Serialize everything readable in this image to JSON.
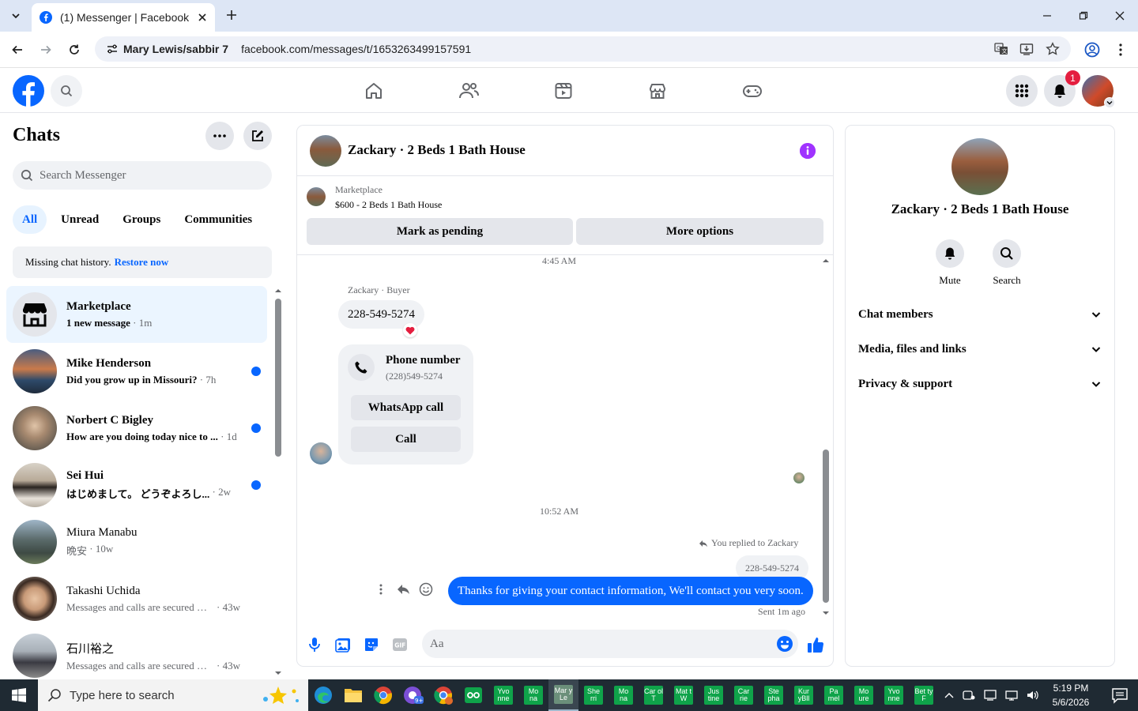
{
  "browser": {
    "tab_title": "(1) Messenger | Facebook",
    "site_chip": "Mary Lewis/sabbir 7",
    "url": "facebook.com/messages/t/1653263499157591"
  },
  "header": {
    "notification_count": "1"
  },
  "sidebar": {
    "title": "Chats",
    "search_placeholder": "Search Messenger",
    "filters": [
      "All",
      "Unread",
      "Groups",
      "Communities"
    ],
    "missing_text": "Missing chat history.",
    "restore_link": "Restore now",
    "chats": [
      {
        "name": "Marketplace",
        "preview": "1 new message",
        "time": "· 1m",
        "unread": true,
        "selected": true
      },
      {
        "name": "Mike Henderson",
        "preview": "Did you grow up in Missouri?",
        "time": "· 7h",
        "unread": true
      },
      {
        "name": "Norbert C Bigley",
        "preview": "How are you doing today nice to ...",
        "time": "· 1d",
        "unread": true
      },
      {
        "name": "Sei Hui",
        "preview": "はじめまして。 どうぞよろし...",
        "time": "· 2w",
        "unread": true
      },
      {
        "name": "Miura Manabu",
        "preview": "晩安",
        "time": "· 10w",
        "unread": false
      },
      {
        "name": "Takashi Uchida",
        "preview": "Messages and calls are secured with...",
        "time": "· 43w",
        "unread": false
      },
      {
        "name": "石川裕之",
        "preview": "Messages and calls are secured with...",
        "time": "· 43w",
        "unread": false
      }
    ]
  },
  "conversation": {
    "title": "Zackary · 2 Beds 1 Bath House",
    "marketplace_label": "Marketplace",
    "listing": "$600 - 2 Beds 1 Bath House",
    "mark_pending": "Mark as pending",
    "more_options": "More options",
    "time1": "4:45 AM",
    "sender_label": "Zackary · Buyer",
    "msg1": "228-549-5274",
    "card_title": "Phone number",
    "card_number": "(228)549-5274",
    "whatsapp_btn": "WhatsApp call",
    "call_btn": "Call",
    "time2": "10:52 AM",
    "replied_label": "You replied to Zackary",
    "quoted": "228-549-5274",
    "my_msg": "Thanks for giving your contact information, We'll contact you very soon.",
    "sent_label": "Sent 1m ago",
    "composer_placeholder": "Aa"
  },
  "right_panel": {
    "name": "Zackary · 2 Beds 1 Bath House",
    "mute": "Mute",
    "search": "Search",
    "sections": [
      "Chat members",
      "Media, files and links",
      "Privacy & support"
    ]
  },
  "taskbar": {
    "search_placeholder": "Type here to search",
    "tiles": [
      "Yvo nne",
      "Mo na",
      "Mar y Le",
      "She rri",
      "Mo na",
      "Car ol T",
      "Mat t W",
      "Jus tine",
      "Car rie",
      "Ste pha",
      "Kur yBll",
      "Pa mel",
      "Mo ure",
      "Yvo nne",
      "Bet ty F"
    ],
    "time": "5:19 PM",
    "date": "5/6/2026"
  },
  "colors": {
    "accent": "#0866ff",
    "badge": "#e41e3f",
    "info": "#a033ff"
  }
}
